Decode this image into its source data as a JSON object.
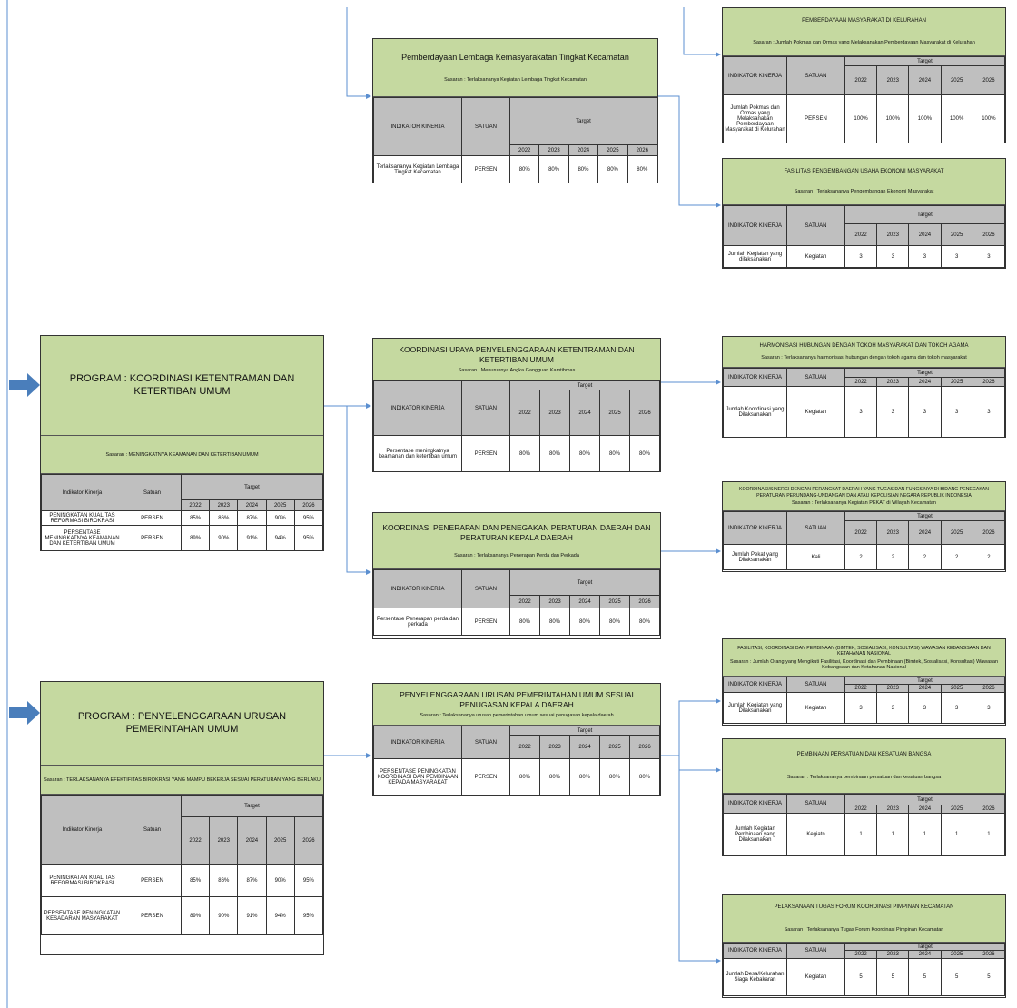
{
  "header_cols": {
    "indikator": "INDIKATOR KINERJA",
    "satuan": "SATUAN",
    "target": "Target",
    "years": [
      "2022",
      "2023",
      "2024",
      "2025",
      "2026"
    ]
  },
  "header_cols_program": {
    "indikator": "Indikator Kinerja",
    "satuan": "Satuan",
    "target": "Target",
    "years": [
      "2022",
      "2023",
      "2024",
      "2025",
      "2026"
    ]
  },
  "programs": [
    {
      "title": "PROGRAM : KOORDINASI KETENTRAMAN DAN KETERTIBAN UMUM",
      "sasaran": "Sasaran : MENINGKATNYA KEAMANAN DAN KETERTIBAN UMUM",
      "rows": [
        {
          "indikator": "PENINGKATAN KUALITAS REFORMASI BIROKRASI",
          "satuan": "PERSEN",
          "values": [
            "85%",
            "86%",
            "87%",
            "90%",
            "95%"
          ]
        },
        {
          "indikator": "PERSENTASE MENINGKATNYA KEAMANAN DAN KETERTIBAN UMUM",
          "satuan": "PERSEN",
          "values": [
            "89%",
            "90%",
            "91%",
            "94%",
            "95%"
          ]
        }
      ]
    },
    {
      "title": "PROGRAM : PENYELENGGARAAN URUSAN PEMERINTAHAN UMUM",
      "sasaran": "Sasaran : TERLAKSANANYA EFEKTIFITAS BIROKRASI YANG MAMPU BEKERJA SESUAI PERATURAN YANG BERLAKU",
      "rows": [
        {
          "indikator": "PENINGKATAN KUALITAS REFORMASI BIROKRASI",
          "satuan": "PERSEN",
          "values": [
            "85%",
            "86%",
            "87%",
            "90%",
            "95%"
          ]
        },
        {
          "indikator": "PERSENTASE PENINGKATAN KESADARAN MASYARAKAT",
          "satuan": "PERSEN",
          "values": [
            "89%",
            "90%",
            "91%",
            "94%",
            "95%"
          ]
        }
      ]
    }
  ],
  "kegiatan": [
    {
      "title": "Pemberdayaan Lembaga Kemasyarakatan Tingkat Kecamatan",
      "sasaran": "Sasaran : Terlaksananya Kegiatan Lembaga Tingkat Kecamatan",
      "rows": [
        {
          "indikator": "Terlaksananya Kegiatan Lembaga Tingkat Kecamatan",
          "satuan": "PERSEN",
          "values": [
            "80%",
            "80%",
            "80%",
            "80%",
            "80%"
          ]
        }
      ]
    },
    {
      "title": "KOORDINASI UPAYA PENYELENGGARAAN KETENTRAMAN DAN KETERTIBAN UMUM",
      "sasaran": "Sasaran : Menurunnya Angka Gangguan Kamtibmas",
      "rows": [
        {
          "indikator": "Persentase meningkatnya keamanan dan ketertiban umum",
          "satuan": "PERSEN",
          "values": [
            "80%",
            "80%",
            "80%",
            "80%",
            "80%"
          ]
        }
      ]
    },
    {
      "title": "KOORDINASI PENERAPAN DAN PENEGAKAN PERATURAN DAERAH DAN PERATURAN KEPALA DAERAH",
      "sasaran": "Sasaran : Terlaksananya Penerapan Perda dan Perkada",
      "rows": [
        {
          "indikator": "Persentase Penerapan perda dan perkada",
          "satuan": "PERSEN",
          "values": [
            "80%",
            "80%",
            "80%",
            "80%",
            "80%"
          ]
        }
      ]
    },
    {
      "title": "PENYELENGGARAAN URUSAN PEMERINTAHAN UMUM SESUAI PENUGASAN KEPALA DAERAH",
      "sasaran": "Sasaran : Terlaksananya urusan pemerintahan umum sesuai penugasan kepala daerah",
      "rows": [
        {
          "indikator": "PERSENTASE PENINGKATAN KOORDINASI DAN PEMBINAAN KEPADA MASYARAKAT",
          "satuan": "PERSEN",
          "values": [
            "80%",
            "80%",
            "80%",
            "80%",
            "80%"
          ]
        }
      ]
    }
  ],
  "subkegiatan": [
    {
      "title": "PEMBERDAYAAN MASYARAKAT DI KELURAHAN",
      "sasaran": "Sasaran : Jumlah Pokmas dan Ormas yang Melaksanakan Pemberdayaan Masyarakat di Kelurahan",
      "rows": [
        {
          "indikator": "Jumlah Pokmas dan Ormas yang Melaksanakan Pemberdayaan Masyarakat di Kelurahan",
          "satuan": "PERSEN",
          "values": [
            "100%",
            "100%",
            "100%",
            "100%",
            "100%"
          ]
        }
      ]
    },
    {
      "title": "FASILITAS PENGEMBANGAN USAHA EKONOMI MASYARAKAT",
      "sasaran": "Sasaran : Terlaksananya Pengembangan Ekonomi Masyarakat",
      "rows": [
        {
          "indikator": "Jumlah Kegiatan yang dilaksanakan",
          "satuan": "Kegiatan",
          "values": [
            "3",
            "3",
            "3",
            "3",
            "3"
          ]
        }
      ]
    },
    {
      "title": "HARMONISASI HUBUNGAN DENGAN TOKOH MASYARAKAT DAN TOKOH AGAMA",
      "sasaran": "Sasaran : Terlaksananya harmonisasi hubungan dengan tokoh agama dan tokoh masyarakat",
      "rows": [
        {
          "indikator": "Jumlah Koordinasi yang Dilaksanakan",
          "satuan": "Kegiatan",
          "values": [
            "3",
            "3",
            "3",
            "3",
            "3"
          ]
        }
      ]
    },
    {
      "title": "KOORDINASI/SINERGI DENGAN PERANGKAT DAERAH YANG TUGAS DAN FUNGSINYA DI BIDANG PENEGAKAN PERATURAN PERUNDANG-UNDANGAN DAN ATAU KEPOLISIAN NEGARA REPUBLIK INDONESIA",
      "sasaran": "Sasaran : Terlaksananya Kegiatan PEKAT di Wilayah Kecamatan",
      "rows": [
        {
          "indikator": "Jumlah Pekat yang Dilaksanakan",
          "satuan": "Kali",
          "values": [
            "2",
            "2",
            "2",
            "2",
            "2"
          ]
        }
      ]
    },
    {
      "title": "FASILITASI, KOORDINASI DAN PEMBINAAN (BIMTEK, SOSIALISASI, KONSULTASI) WAWASAN KEBANGSAAN DAN KETAHANAN NASIONAL",
      "sasaran": "Sasaran : Jumlah Orang yang Mengikuti Fasilitasi, Koordinasi dan Pembinaan (Bimtek, Sosialisasi, Konsultasi) Wawasan Kebangsaan dan Ketahanan Nasional",
      "rows": [
        {
          "indikator": "Jumlah Kegiatan yang Dilaksanakan",
          "satuan": "Kegiatan",
          "values": [
            "3",
            "3",
            "3",
            "3",
            "3"
          ]
        }
      ]
    },
    {
      "title": "PEMBINAAN PERSATUAN DAN KESATUAN BANGSA",
      "sasaran": "Sasaran : Terlaksananya pembinaan persatuan dan kesatuan bangsa",
      "rows": [
        {
          "indikator": "Jumlah Kegiatan Pembinaan yang Dilaksanakan",
          "satuan": "Kegiatn",
          "values": [
            "1",
            "1",
            "1",
            "1",
            "1"
          ]
        }
      ]
    },
    {
      "title": "PELAKSANAAN TUGAS FORUM KOORDINASI PIMPINAN KECAMATAN",
      "sasaran": "Sasaran : Terlaksananya Tugas Forum Koordinasi Pimpinan Kecamatan",
      "rows": [
        {
          "indikator": "Jumlah Desa/Kelurahan Siaga Kebakaran",
          "satuan": "Kegiatan",
          "values": [
            "5",
            "5",
            "5",
            "5",
            "5"
          ]
        }
      ]
    }
  ],
  "colors": {
    "header_green": "#c5d9a0",
    "table_header_grey": "#bfbfbf",
    "arrow_blue": "#4a7ebb",
    "line_blue": "#5b8fd0"
  }
}
